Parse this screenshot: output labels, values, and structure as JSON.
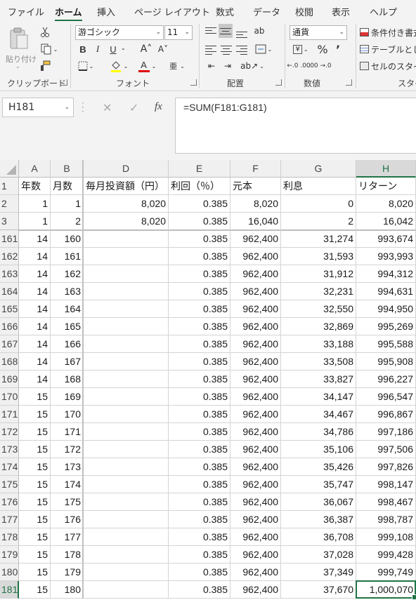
{
  "menu": {
    "tabs": [
      "ファイル",
      "ホーム",
      "挿入",
      "ページ レイアウト",
      "数式",
      "データ",
      "校閲",
      "表示",
      "ヘルプ"
    ],
    "active": "ホーム"
  },
  "ribbon": {
    "clipboard": {
      "label": "クリップボード",
      "paste_label": "貼り付け"
    },
    "font": {
      "label": "フォント",
      "font_name": "游ゴシック",
      "font_size": "11",
      "bold": "B",
      "italic": "I",
      "underline": "U",
      "grow": "A˄",
      "shrink": "A˅",
      "font_color_letter": "A",
      "highlight_color": "#ffff00",
      "font_color": "#e00000",
      "phonetic": "亜"
    },
    "alignment": {
      "label": "配置"
    },
    "number": {
      "label": "数値",
      "format": "通貨",
      "percent": "%",
      "comma": "’",
      "currency_icon": "¥",
      "inc_decimal": "←.0 .00",
      "dec_decimal": ".00 →.0"
    },
    "styles": {
      "label": "スタイ",
      "conditional": "条件付き書式",
      "table": "テーブルとして",
      "cell_styles": "セルのスタイル"
    }
  },
  "formula_bar": {
    "name_box": "H181",
    "cancel_glyph": "✕",
    "enter_glyph": "✓",
    "fx_glyph": "fx",
    "formula": "=SUM(F181:G181)"
  },
  "sheet": {
    "columns": [
      "A",
      "B",
      "D",
      "E",
      "F",
      "G",
      "H"
    ],
    "selected_column": "H",
    "selected_row": "181",
    "accent_color": "#217346",
    "rows": [
      {
        "n": "1",
        "cells": [
          "年数",
          "月数",
          "毎月投資額（円）",
          "利回（％）",
          "元本",
          "利息",
          "リターン"
        ],
        "header": true
      },
      {
        "n": "2",
        "cells": [
          "1",
          "1",
          "8,020",
          "0.385",
          "8,020",
          "0",
          "8,020"
        ]
      },
      {
        "n": "3",
        "cells": [
          "1",
          "2",
          "8,020",
          "0.385",
          "16,040",
          "2",
          "16,042"
        ]
      },
      {
        "n": "161",
        "cells": [
          "14",
          "160",
          "",
          "0.385",
          "962,400",
          "31,274",
          "993,674"
        ]
      },
      {
        "n": "162",
        "cells": [
          "14",
          "161",
          "",
          "0.385",
          "962,400",
          "31,593",
          "993,993"
        ]
      },
      {
        "n": "163",
        "cells": [
          "14",
          "162",
          "",
          "0.385",
          "962,400",
          "31,912",
          "994,312"
        ]
      },
      {
        "n": "164",
        "cells": [
          "14",
          "163",
          "",
          "0.385",
          "962,400",
          "32,231",
          "994,631"
        ]
      },
      {
        "n": "165",
        "cells": [
          "14",
          "164",
          "",
          "0.385",
          "962,400",
          "32,550",
          "994,950"
        ]
      },
      {
        "n": "166",
        "cells": [
          "14",
          "165",
          "",
          "0.385",
          "962,400",
          "32,869",
          "995,269"
        ]
      },
      {
        "n": "167",
        "cells": [
          "14",
          "166",
          "",
          "0.385",
          "962,400",
          "33,188",
          "995,588"
        ]
      },
      {
        "n": "168",
        "cells": [
          "14",
          "167",
          "",
          "0.385",
          "962,400",
          "33,508",
          "995,908"
        ]
      },
      {
        "n": "169",
        "cells": [
          "14",
          "168",
          "",
          "0.385",
          "962,400",
          "33,827",
          "996,227"
        ]
      },
      {
        "n": "170",
        "cells": [
          "15",
          "169",
          "",
          "0.385",
          "962,400",
          "34,147",
          "996,547"
        ]
      },
      {
        "n": "171",
        "cells": [
          "15",
          "170",
          "",
          "0.385",
          "962,400",
          "34,467",
          "996,867"
        ]
      },
      {
        "n": "172",
        "cells": [
          "15",
          "171",
          "",
          "0.385",
          "962,400",
          "34,786",
          "997,186"
        ]
      },
      {
        "n": "173",
        "cells": [
          "15",
          "172",
          "",
          "0.385",
          "962,400",
          "35,106",
          "997,506"
        ]
      },
      {
        "n": "174",
        "cells": [
          "15",
          "173",
          "",
          "0.385",
          "962,400",
          "35,426",
          "997,826"
        ]
      },
      {
        "n": "175",
        "cells": [
          "15",
          "174",
          "",
          "0.385",
          "962,400",
          "35,747",
          "998,147"
        ]
      },
      {
        "n": "176",
        "cells": [
          "15",
          "175",
          "",
          "0.385",
          "962,400",
          "36,067",
          "998,467"
        ]
      },
      {
        "n": "177",
        "cells": [
          "15",
          "176",
          "",
          "0.385",
          "962,400",
          "36,387",
          "998,787"
        ]
      },
      {
        "n": "178",
        "cells": [
          "15",
          "177",
          "",
          "0.385",
          "962,400",
          "36,708",
          "999,108"
        ]
      },
      {
        "n": "179",
        "cells": [
          "15",
          "178",
          "",
          "0.385",
          "962,400",
          "37,028",
          "999,428"
        ]
      },
      {
        "n": "180",
        "cells": [
          "15",
          "179",
          "",
          "0.385",
          "962,400",
          "37,349",
          "999,749"
        ]
      },
      {
        "n": "181",
        "cells": [
          "15",
          "180",
          "",
          "0.385",
          "962,400",
          "37,670",
          "1,000,070"
        ]
      }
    ]
  }
}
